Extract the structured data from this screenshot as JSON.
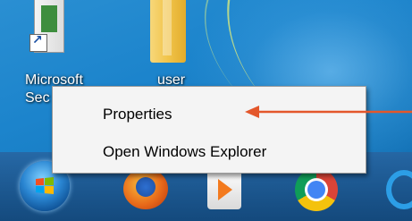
{
  "desktop": {
    "icons": [
      {
        "label_line1": "Microsoft",
        "label_line2": "Sec"
      },
      {
        "label_line1": "user"
      }
    ]
  },
  "context_menu": {
    "items": [
      {
        "label": "Properties"
      },
      {
        "label": "Open Windows Explorer"
      }
    ]
  },
  "taskbar": {
    "pinned": [
      "windows-start-icon",
      "firefox-icon",
      "media-player-icon",
      "chrome-icon",
      "internet-explorer-icon"
    ]
  },
  "colors": {
    "annotation_arrow": "#e3572b",
    "menu_background": "#f4f4f4"
  }
}
